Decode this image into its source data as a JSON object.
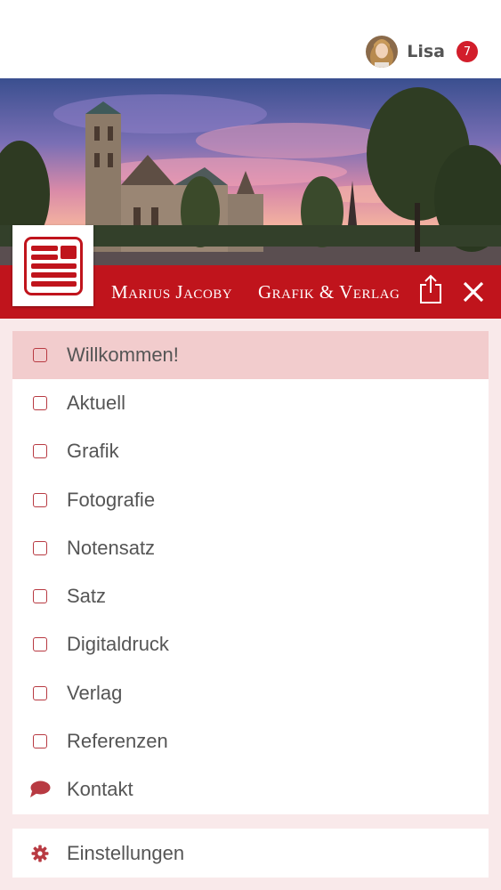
{
  "user": {
    "name": "Lisa",
    "notification_count": "7"
  },
  "brand": {
    "name": "Marius Jacoby",
    "tagline": "Grafik & Verlag",
    "logo_icon": "newspaper-logo-icon",
    "color": "#c0141c"
  },
  "header_actions": {
    "share_icon": "share-icon",
    "close_icon": "close-icon"
  },
  "menu": {
    "items": [
      {
        "label": "Willkommen!",
        "icon": "checkbox-icon",
        "active": true
      },
      {
        "label": "Aktuell",
        "icon": "checkbox-icon"
      },
      {
        "label": "Grafik",
        "icon": "checkbox-icon"
      },
      {
        "label": "Fotografie",
        "icon": "checkbox-icon"
      },
      {
        "label": "Notensatz",
        "icon": "checkbox-icon"
      },
      {
        "label": "Satz",
        "icon": "checkbox-icon"
      },
      {
        "label": "Digitaldruck",
        "icon": "checkbox-icon"
      },
      {
        "label": "Verlag",
        "icon": "checkbox-icon"
      },
      {
        "label": "Referenzen",
        "icon": "checkbox-icon"
      },
      {
        "label": "Kontakt",
        "icon": "speech-bubble-icon"
      }
    ]
  },
  "settings": {
    "label": "Einstellungen",
    "icon": "gear-icon"
  },
  "colors": {
    "accent": "#c0141c",
    "active_item_bg": "#f2cccd",
    "panel_bg": "#f9e9ea",
    "badge": "#d21e2b"
  }
}
